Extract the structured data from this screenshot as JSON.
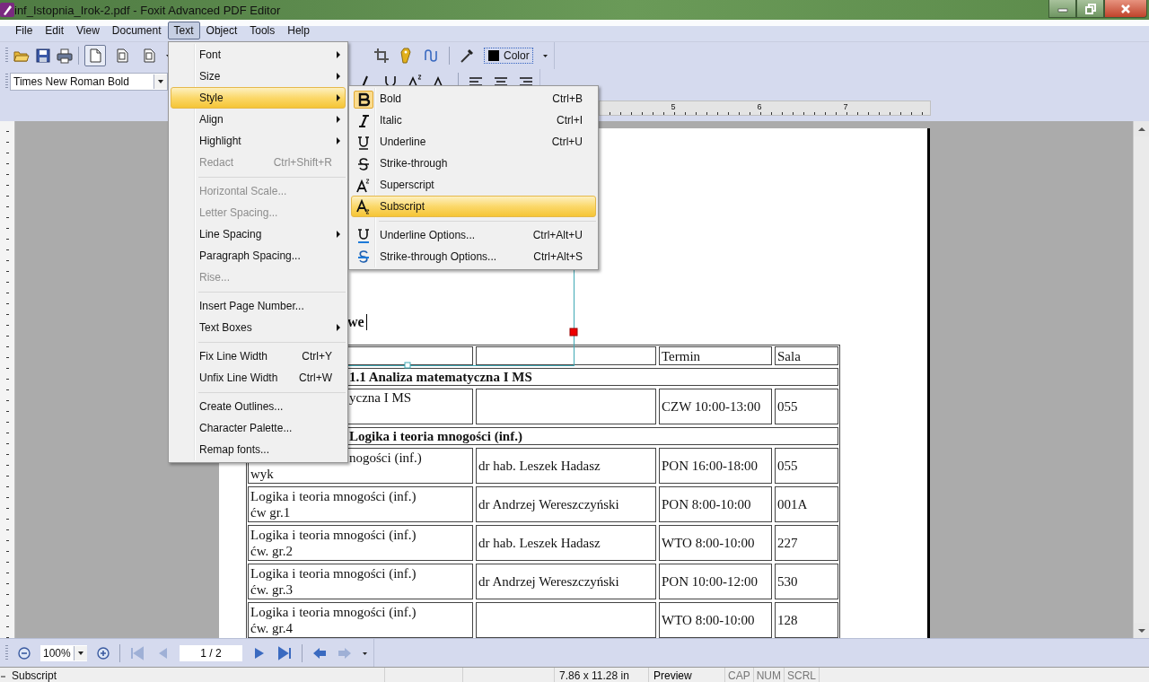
{
  "window": {
    "title": "inf_Istopnia_Irok-2.pdf - Foxit Advanced PDF Editor"
  },
  "menu_bar": [
    {
      "label": "File",
      "selected": false
    },
    {
      "label": "Edit",
      "selected": false
    },
    {
      "label": "View",
      "selected": false
    },
    {
      "label": "Document",
      "selected": false
    },
    {
      "label": "Text",
      "selected": true
    },
    {
      "label": "Object",
      "selected": false
    },
    {
      "label": "Tools",
      "selected": false
    },
    {
      "label": "Help",
      "selected": false
    }
  ],
  "toolbar": {
    "page_views": [
      {
        "selected": true
      },
      {
        "selected": false
      },
      {
        "selected": false
      }
    ],
    "color_label": "Color",
    "font": "Times New Roman Bold"
  },
  "ruler": {
    "labels": [
      "5",
      "6",
      "7"
    ]
  },
  "text_menu": [
    {
      "kind": "item",
      "label": "Font",
      "submenu": true,
      "disabled": false,
      "selected": false
    },
    {
      "kind": "item",
      "label": "Size",
      "submenu": true,
      "disabled": false,
      "selected": false
    },
    {
      "kind": "item",
      "label": "Style",
      "submenu": true,
      "disabled": false,
      "selected": true
    },
    {
      "kind": "item",
      "label": "Align",
      "submenu": true,
      "disabled": false,
      "selected": false
    },
    {
      "kind": "item",
      "label": "Highlight",
      "submenu": true,
      "disabled": false,
      "selected": false
    },
    {
      "kind": "item",
      "label": "Redact",
      "shortcut": "Ctrl+Shift+R",
      "submenu": false,
      "disabled": true,
      "selected": false
    },
    {
      "kind": "separator"
    },
    {
      "kind": "item",
      "label": "Horizontal Scale...",
      "submenu": false,
      "disabled": true,
      "selected": false
    },
    {
      "kind": "item",
      "label": "Letter Spacing...",
      "submenu": false,
      "disabled": true,
      "selected": false
    },
    {
      "kind": "item",
      "label": "Line Spacing",
      "submenu": true,
      "disabled": false,
      "selected": false
    },
    {
      "kind": "item",
      "label": "Paragraph Spacing...",
      "submenu": false,
      "disabled": false,
      "selected": false
    },
    {
      "kind": "item",
      "label": "Rise...",
      "submenu": false,
      "disabled": true,
      "selected": false
    },
    {
      "kind": "separator"
    },
    {
      "kind": "item",
      "label": "Insert Page Number...",
      "submenu": false,
      "disabled": false,
      "selected": false
    },
    {
      "kind": "item",
      "label": "Text Boxes",
      "submenu": true,
      "disabled": false,
      "selected": false
    },
    {
      "kind": "separator"
    },
    {
      "kind": "item",
      "label": "Fix Line Width",
      "shortcut": "Ctrl+Y",
      "submenu": false,
      "disabled": false,
      "selected": false
    },
    {
      "kind": "item",
      "label": "Unfix Line Width",
      "shortcut": "Ctrl+W",
      "submenu": false,
      "disabled": false,
      "selected": false
    },
    {
      "kind": "separator"
    },
    {
      "kind": "item",
      "label": "Create Outlines...",
      "submenu": false,
      "disabled": false,
      "selected": false
    },
    {
      "kind": "item",
      "label": "Character Palette...",
      "submenu": false,
      "disabled": false,
      "selected": false
    },
    {
      "kind": "item",
      "label": "Remap fonts...",
      "submenu": false,
      "disabled": false,
      "selected": false
    }
  ],
  "style_menu": [
    {
      "kind": "bold",
      "label": "Bold",
      "shortcut": "Ctrl+B",
      "checked": true,
      "selected": false
    },
    {
      "kind": "italic",
      "label": "Italic",
      "shortcut": "Ctrl+I",
      "checked": false,
      "selected": false
    },
    {
      "kind": "underline",
      "label": "Underline",
      "shortcut": "Ctrl+U",
      "checked": false,
      "selected": false
    },
    {
      "kind": "strike",
      "label": "Strike-through",
      "checked": false,
      "selected": false
    },
    {
      "kind": "superscript",
      "label": "Superscript",
      "checked": false,
      "selected": false
    },
    {
      "kind": "subscript",
      "label": "Subscript",
      "checked": false,
      "selected": true
    },
    {
      "kind": "separator"
    },
    {
      "kind": "underline-options",
      "label": "Underline Options...",
      "shortcut": "Ctrl+Alt+U",
      "checked": false,
      "selected": false
    },
    {
      "kind": "strike-options",
      "label": "Strike-through Options...",
      "shortcut": "Ctrl+Alt+S",
      "checked": false,
      "selected": false
    }
  ],
  "document": {
    "heading": "we",
    "rows": [
      {
        "kind": "header",
        "cells": [
          {},
          {},
          {
            "text": "Termin"
          },
          {
            "text": "Sala"
          }
        ]
      },
      {
        "kind": "section",
        "text": "1.1 Analiza matematyczna I MS",
        "cut": true
      },
      {
        "kind": "row",
        "cells": [
          {
            "text": "yczna I MS",
            "cut": true
          },
          {},
          {
            "text": "CZW 10:00-13:00"
          },
          {
            "text": "055"
          }
        ]
      },
      {
        "kind": "section",
        "text": "Logika i teoria mnogości (inf.)",
        "cut": true
      },
      {
        "kind": "row",
        "cells": [
          {
            "text": "nogości (inf.)\nwyk",
            "cut": true
          },
          {
            "text": "dr hab. Leszek Hadasz"
          },
          {
            "text": "PON 16:00-18:00"
          },
          {
            "text": "055"
          }
        ]
      },
      {
        "kind": "row",
        "cells": [
          {
            "text": "Logika i teoria mnogości (inf.)\nćw gr.1"
          },
          {
            "text": "dr Andrzej Wereszczyński"
          },
          {
            "text": "PON 8:00-10:00"
          },
          {
            "text": "001A"
          }
        ]
      },
      {
        "kind": "row",
        "cells": [
          {
            "text": "Logika i teoria mnogości (inf.)\nćw. gr.2"
          },
          {
            "text": "dr hab. Leszek Hadasz"
          },
          {
            "text": "WTO 8:00-10:00"
          },
          {
            "text": "227"
          }
        ]
      },
      {
        "kind": "row",
        "cells": [
          {
            "text": "Logika i teoria mnogości (inf.)\nćw. gr.3"
          },
          {
            "text": "dr Andrzej Wereszczyński"
          },
          {
            "text": "PON 10:00-12:00"
          },
          {
            "text": "530"
          }
        ]
      },
      {
        "kind": "row",
        "cells": [
          {
            "text": "Logika i teoria mnogości (inf.)\nćw. gr.4"
          },
          {},
          {
            "text": "WTO 8:00-10:00"
          },
          {
            "text": "128"
          }
        ]
      }
    ]
  },
  "navigation": {
    "zoom": "100%",
    "page": "1 / 2"
  },
  "status_bar": {
    "message": "Subscript",
    "page_size": "7.86 x 11.28 in",
    "mode": "Preview",
    "indicators": [
      "CAP",
      "NUM",
      "SCRL"
    ]
  }
}
